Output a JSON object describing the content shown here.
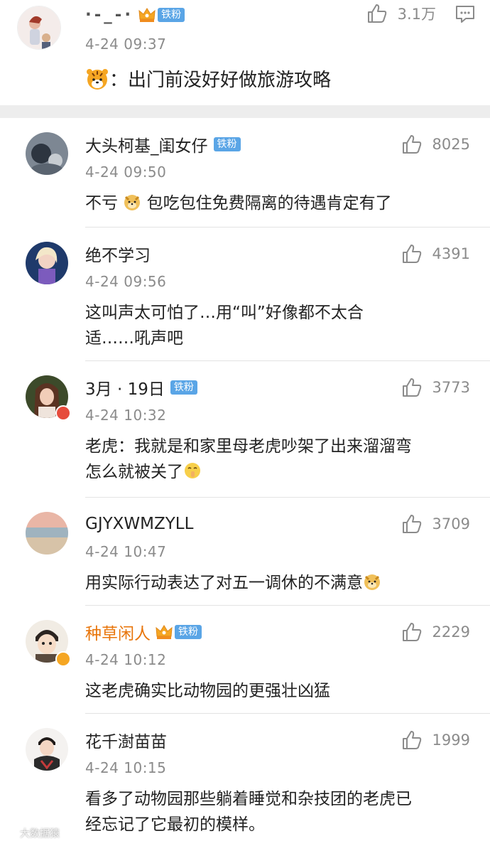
{
  "top_post": {
    "username": "·-_-·",
    "badge": "铁粉",
    "timestamp": "4-24 09:37",
    "likes": "3.1万",
    "text": "：出门前没好好做旅游攻略"
  },
  "comments": [
    {
      "username": "大头柯基_闺女仔",
      "badge": "铁粉",
      "timestamp": "4-24 09:50",
      "likes": "8025",
      "text_a": "不亏",
      "text_b": "包吃包住免费隔离的待遇肯定有了"
    },
    {
      "username": "绝不学习",
      "timestamp": "4-24 09:56",
      "likes": "4391",
      "line1": "这叫声太可怕了…用“叫”好像都不太合",
      "line2": "适……吼声吧"
    },
    {
      "username": "3月 · 19日",
      "badge": "铁粉",
      "timestamp": "4-24 10:32",
      "likes": "3773",
      "line1": "老虎：我就是和家里母老虎吵架了出来溜溜弯",
      "line2": "怎么就被关了"
    },
    {
      "username": "GJYXWMZYLL",
      "timestamp": "4-24 10:47",
      "likes": "3709",
      "text": "用实际行动表达了对五一调休的不满意"
    },
    {
      "username": "种草闲人",
      "badge": "铁粉",
      "timestamp": "4-24 10:12",
      "likes": "2229",
      "text": "这老虎确实比动物园的更强壮凶猛"
    },
    {
      "username": "花千澍苗苗",
      "timestamp": "4-24 10:15",
      "likes": "1999",
      "line1": "看多了动物园那些躺着睡觉和杂技团的老虎已",
      "line2": "经忘记了它最初的模样。"
    }
  ],
  "watermark": {
    "text": "大数据猿"
  },
  "colors": {
    "badge_blue": "#5aa5e6",
    "vip_orange": "#e8750a",
    "meta_gray": "#8b8b8b",
    "divider": "#e3e3e3",
    "gap": "#ededed"
  },
  "icons": [
    "thumb-up-icon",
    "reply-icon",
    "crown-icon",
    "tiger-emoji",
    "doge-emoji",
    "shush-emoji"
  ]
}
